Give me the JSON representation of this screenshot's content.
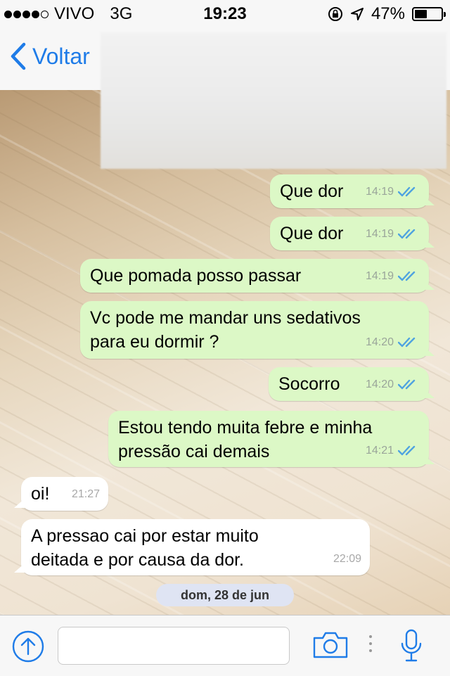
{
  "status_bar": {
    "carrier": "VIVO",
    "network": "3G",
    "time": "19:23",
    "battery_text": "47%",
    "battery_level": 0.47,
    "signal_bars_filled": 4,
    "signal_bars_total": 5
  },
  "nav": {
    "back_label": "Voltar"
  },
  "messages": [
    {
      "dir": "out",
      "text": "Que dor",
      "time": "14:19",
      "read": true
    },
    {
      "dir": "out",
      "text": "Que dor",
      "time": "14:19",
      "read": true
    },
    {
      "dir": "out",
      "text": "Que pomada posso passar",
      "time": "14:19",
      "read": true
    },
    {
      "dir": "out",
      "text": "Vc pode me mandar uns sedativos\npara eu dormir ?",
      "time": "14:20",
      "read": true
    },
    {
      "dir": "out",
      "text": "Socorro",
      "time": "14:20",
      "read": true
    },
    {
      "dir": "out",
      "text": "Estou tendo muita febre e minha\npressão cai demais",
      "time": "14:21",
      "read": true
    },
    {
      "dir": "in",
      "text": "oi!",
      "time": "21:27"
    },
    {
      "dir": "in",
      "text": "A pressao cai por estar muito\ndeitada e por causa da dor.",
      "time": "22:09"
    }
  ],
  "date_separator": "dom, 28 de jun",
  "input": {
    "placeholder": ""
  },
  "colors": {
    "accent": "#1f7ce8",
    "outgoing_bubble": "#dcf8c6",
    "incoming_bubble": "#ffffff",
    "read_ticks": "#4fa3e0"
  }
}
